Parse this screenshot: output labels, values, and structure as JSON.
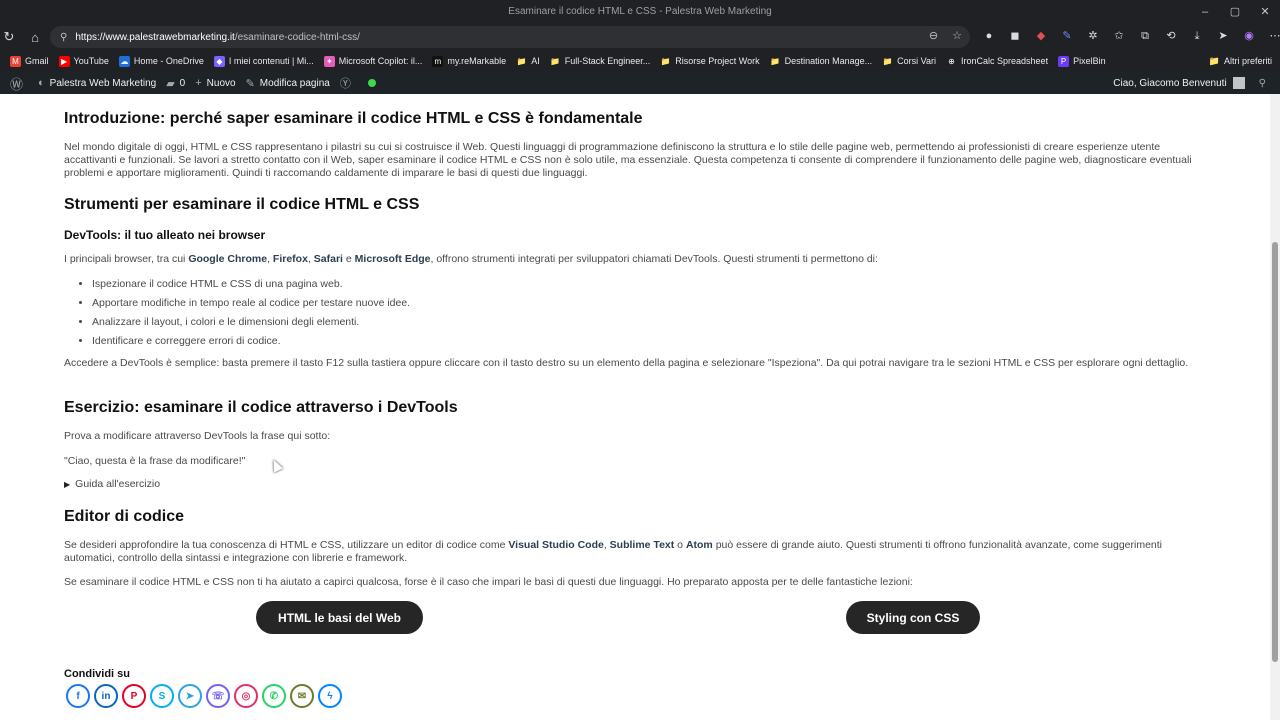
{
  "browser": {
    "tab_title": "Esaminare il codice HTML e CSS - Palestra Web Marketing",
    "url_host": "https://www.palestrawebmarketing.it",
    "url_path": "/esaminare-codice-html-css/",
    "bookmarks": [
      {
        "label": "Gmail",
        "color": "#ea4335",
        "glyph": "M"
      },
      {
        "label": "YouTube",
        "color": "#ff0000",
        "glyph": "▶"
      },
      {
        "label": "Home - OneDrive",
        "color": "#1e6fd9",
        "glyph": "☁"
      },
      {
        "label": "I miei contenuti | Mi...",
        "color": "#7b61ff",
        "glyph": "◆"
      },
      {
        "label": "Microsoft Copilot: il...",
        "color": "#e25cb8",
        "glyph": "✦"
      },
      {
        "label": "my.reMarkable",
        "color": "#111111",
        "glyph": "m"
      },
      {
        "label": "AI",
        "color": "transparent",
        "glyph": "📁"
      },
      {
        "label": "Full-Stack Engineer...",
        "color": "transparent",
        "glyph": "📁"
      },
      {
        "label": "Risorse Project Work",
        "color": "transparent",
        "glyph": "📁"
      },
      {
        "label": "Destination Manage...",
        "color": "transparent",
        "glyph": "📁"
      },
      {
        "label": "Corsi Vari",
        "color": "transparent",
        "glyph": "📁"
      },
      {
        "label": "IronCalc Spreadsheet",
        "color": "transparent",
        "glyph": "⊕"
      },
      {
        "label": "PixelBin",
        "color": "#6b3cf5",
        "glyph": "P"
      }
    ],
    "other_bookmarks": "Altri preferiti"
  },
  "wp_admin": {
    "site_name": "Palestra Web Marketing",
    "comments_count": "0",
    "new_label": "Nuovo",
    "edit_label": "Modifica pagina",
    "greeting": "Ciao, Giacomo Benvenuti"
  },
  "article": {
    "intro_heading": "Introduzione: perché saper esaminare il codice HTML e CSS è fondamentale",
    "intro_text": "Nel mondo digitale di oggi, HTML e CSS rappresentano i pilastri su cui si costruisce il Web. Questi linguaggi di programmazione definiscono la struttura e lo stile delle pagine web, permettendo ai professionisti di creare esperienze utente accattivanti e funzionali. Se lavori a stretto contatto con il Web, saper esaminare il codice HTML e CSS non è solo utile, ma essenziale. Questa competenza ti consente di comprendere il funzionamento delle pagine web, diagnosticare eventuali problemi e apportare miglioramenti. Quindi ti raccomando caldamente di imparare le basi di questi due linguaggi.",
    "tools_heading": "Strumenti per esaminare il codice HTML e CSS",
    "devtools_heading": "DevTools: il tuo alleato nei browser",
    "devtools_pre": "I principali browser, tra cui ",
    "browser_chrome": "Google Chrome",
    "sep1": ", ",
    "browser_firefox": "Firefox",
    "sep2": ", ",
    "browser_safari": "Safari",
    "sep3": " e ",
    "browser_edge": "Microsoft Edge",
    "devtools_post": ", offrono strumenti integrati per sviluppatori chiamati DevTools. Questi strumenti ti permettono di:",
    "devtools_list": [
      "Ispezionare il codice HTML e CSS di una pagina web.",
      "Apportare modifiche in tempo reale al codice per testare nuove idee.",
      "Analizzare il layout, i colori e le dimensioni degli elementi.",
      "Identificare e correggere errori di codice."
    ],
    "devtools_access": "Accedere a DevTools è semplice: basta premere il tasto F12 sulla tastiera oppure cliccare con il tasto destro su un elemento della pagina e selezionare \"Ispeziona\". Da qui potrai navigare tra le sezioni HTML e CSS per esplorare ogni dettaglio.",
    "exercise_heading": "Esercizio: esaminare il codice attraverso i DevTools",
    "exercise_text": "Prova a modificare attraverso DevTools la frase qui sotto:",
    "exercise_phrase": "\"Ciao, questa è la frase da modificare!\"",
    "exercise_guide": "Guida all'esercizio",
    "editor_heading": "Editor di codice",
    "editor_pre": "Se desideri approfondire la tua conoscenza di HTML e CSS, utilizzare un editor di codice come ",
    "editor_vscode": "Visual Studio Code",
    "editor_sep1": ", ",
    "editor_sublime": "Sublime Text",
    "editor_sep2": " o ",
    "editor_atom": "Atom",
    "editor_post": " può essere di grande aiuto. Questi strumenti ti offrono funzionalità avanzate, come suggerimenti automatici, controllo della sintassi e integrazione con librerie e framework.",
    "lessons_text": "Se esaminare il codice HTML e CSS non ti ha aiutato a capirci qualcosa, forse è il caso che impari le basi di questi due linguaggi. Ho preparato apposta per te delle fantastiche lezioni:",
    "btn_html": "HTML le basi del Web",
    "btn_css": "Styling con CSS",
    "share_label": "Condividi su"
  },
  "share_icons": [
    {
      "name": "facebook-icon",
      "glyph": "f",
      "color": "#1877f2"
    },
    {
      "name": "linkedin-icon",
      "glyph": "in",
      "color": "#0a66c2"
    },
    {
      "name": "pinterest-icon",
      "glyph": "P",
      "color": "#e60023"
    },
    {
      "name": "skype-icon",
      "glyph": "S",
      "color": "#00aff0"
    },
    {
      "name": "telegram-icon",
      "glyph": "➤",
      "color": "#2aa3df"
    },
    {
      "name": "viber-icon",
      "glyph": "☏",
      "color": "#7360f2"
    },
    {
      "name": "instagram-icon",
      "glyph": "◎",
      "color": "#e1306c"
    },
    {
      "name": "whatsapp-icon",
      "glyph": "✆",
      "color": "#25d366"
    },
    {
      "name": "email-icon",
      "glyph": "✉",
      "color": "#6a7a2a"
    },
    {
      "name": "messenger-icon",
      "glyph": "ϟ",
      "color": "#0084ff"
    }
  ]
}
